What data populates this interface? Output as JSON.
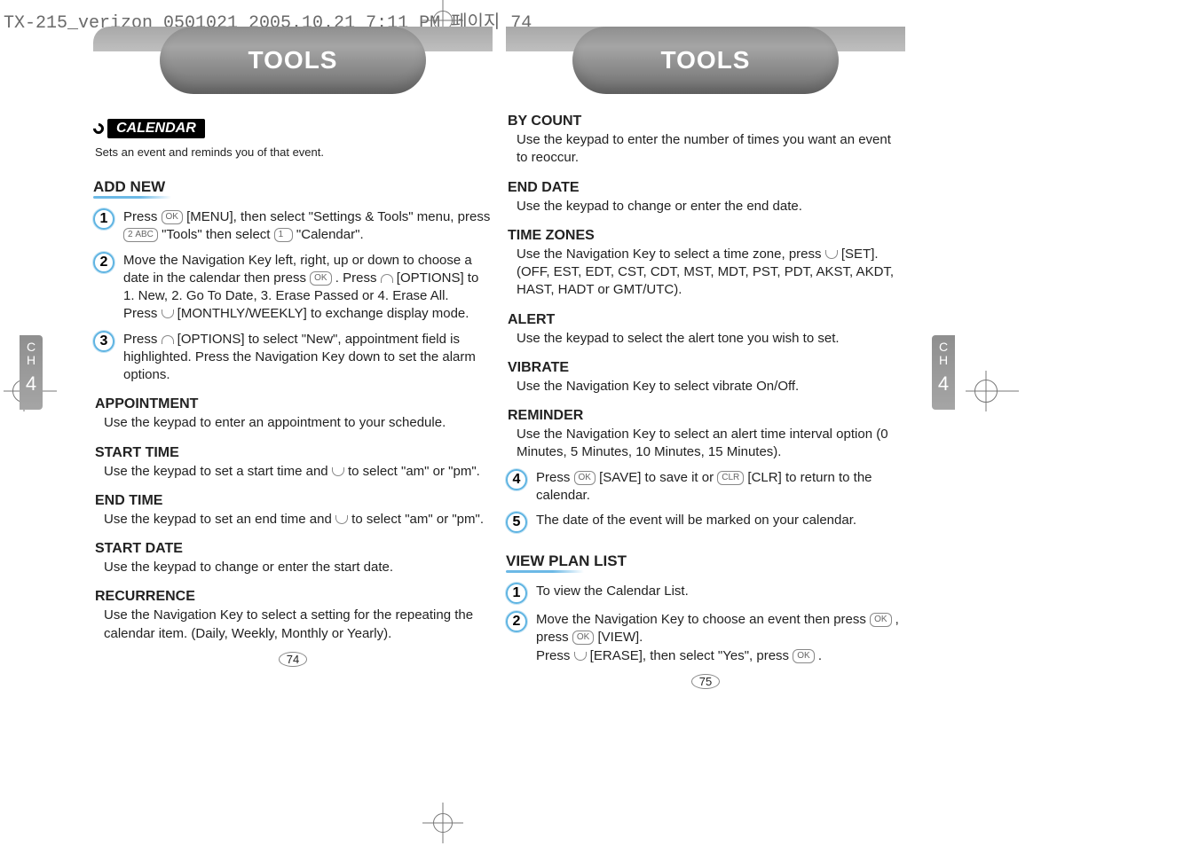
{
  "header_meta": "TX-215_verizon_0501021  2005.10.21  7:11 PM  페이지 74",
  "ch_label": {
    "line1": "C",
    "line2": "H",
    "num": "4"
  },
  "tools_title": "TOOLS",
  "pagenums": {
    "left": "74",
    "right": "75"
  },
  "left": {
    "badge": "CALENDAR",
    "badge_sub": "Sets an event and reminds you of that event.",
    "section_addnew": "ADD NEW",
    "steps_a": [
      "Press       [MENU], then select \"Settings & Tools\" menu, press       \"Tools\" then select       \"Calendar\".",
      "Move the Navigation Key left, right, up or down to choose a date in the calendar then press       . Press       [OPTIONS] to 1. New, 2. Go To Date, 3. Erase Passed or 4. Erase All. Press       [MONTHLY/WEEKLY] to exchange display mode.",
      "Press       [OPTIONS] to select \"New\", appointment field is highlighted. Press the Navigation Key down to set the alarm options."
    ],
    "t_appointment": "APPOINTMENT",
    "b_appointment": "Use the keypad to enter an appointment to your schedule.",
    "t_starttime": "START TIME",
    "b_starttime": "Use the keypad to set a start time and        to select \"am\" or \"pm\".",
    "t_endtime": "END TIME",
    "b_endtime": "Use the keypad to set an end time and        to select \"am\" or \"pm\".",
    "t_startdate": "START DATE",
    "b_startdate": "Use the keypad to change or enter the start date.",
    "t_recurrence": "RECURRENCE",
    "b_recurrence": "Use the Navigation Key to select a setting for the repeating the calendar item. (Daily, Weekly, Monthly or Yearly)."
  },
  "right": {
    "t_bycount": "BY COUNT",
    "b_bycount": "Use the keypad to enter the number of times you want an event to reoccur.",
    "t_enddate": "END DATE",
    "b_enddate": "Use the keypad to change or enter the end date.",
    "t_timezones": "TIME ZONES",
    "b_timezones": "Use the Navigation Key to select a time zone, press       [SET]. (OFF, EST, EDT, CST, CDT, MST, MDT, PST, PDT, AKST, AKDT, HAST, HADT or GMT/UTC).",
    "t_alert": "ALERT",
    "b_alert": "Use the keypad to select the alert tone you wish to set.",
    "t_vibrate": "VIBRATE",
    "b_vibrate": "Use the Navigation Key to select vibrate On/Off.",
    "t_reminder": "REMINDER",
    "b_reminder": "Use the Navigation Key to select an alert time interval option (0 Minutes, 5 Minutes, 10 Minutes, 15 Minutes).",
    "steps_b": [
      "Press       [SAVE] to save it or       [CLR] to return to the calendar.",
      "The date of the event will be marked on your calendar."
    ],
    "section_viewplan": "VIEW PLAN LIST",
    "steps_c": [
      "To view the Calendar List.",
      "Move the Navigation Key to choose an event then press       , press       [VIEW]. Press       [ERASE], then select \"Yes\", press       ."
    ]
  }
}
